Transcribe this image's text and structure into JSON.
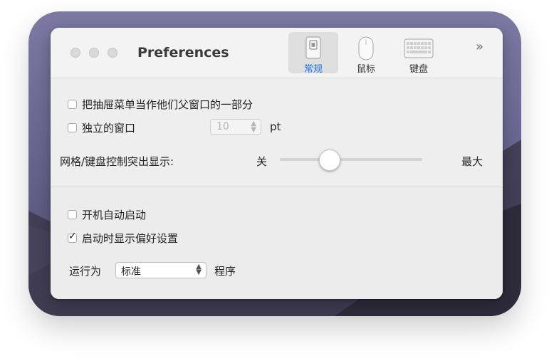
{
  "window": {
    "title": "Preferences"
  },
  "toolbar": {
    "items": [
      {
        "label": "常规",
        "icon": "switch-icon",
        "selected": true
      },
      {
        "label": "鼠标",
        "icon": "mouse-icon",
        "selected": false
      },
      {
        "label": "键盘",
        "icon": "keyboard-icon",
        "selected": false
      }
    ],
    "overflow": "»"
  },
  "general": {
    "drawer_option": {
      "label": "把抽屉菜单当作他们父窗口的一部分",
      "checked": false
    },
    "standalone_window": {
      "label": "独立的窗口",
      "checked": false,
      "value": "10",
      "unit": "pt"
    },
    "grid_emphasis": {
      "label": "网格/键盘控制突出显示:",
      "min_label": "关",
      "max_label": "最大",
      "level": 0.35
    },
    "launch_at_login": {
      "label": "开机自动启动",
      "checked": false
    },
    "show_prefs_on_launch": {
      "label": "启动时显示偏好设置",
      "checked": true
    },
    "run_as": {
      "label": "运行为",
      "value": "标准",
      "suffix": "程序"
    }
  },
  "colors": {
    "accent": "#1d6fe0",
    "window_bg": "#ececec",
    "wallpaper": "#6a6892"
  }
}
